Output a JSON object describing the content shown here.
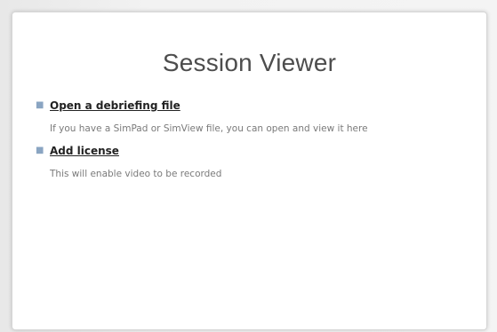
{
  "window": {
    "title": "Session Viewer"
  },
  "actions": [
    {
      "label": "Open a debriefing file",
      "description": "If you have a SimPad or SimView file, you can open and view it here"
    },
    {
      "label": "Add license",
      "description": "This will enable video to be recorded"
    }
  ],
  "colors": {
    "bullet": "#8aa5c2",
    "link": "#222222",
    "description": "#7a7a7a",
    "title": "#4d4d4d"
  }
}
